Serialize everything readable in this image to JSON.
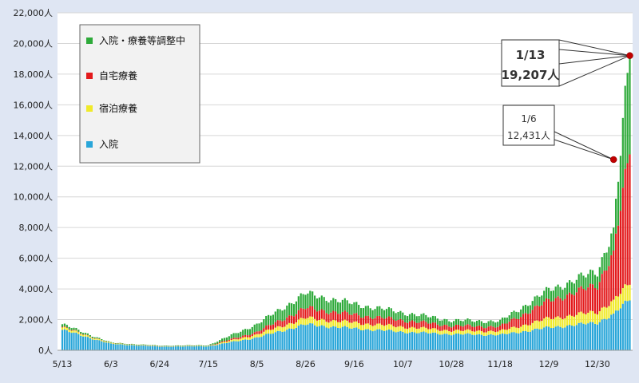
{
  "chart_data": {
    "type": "bar",
    "stacked": true,
    "title": "",
    "xlabel": "",
    "ylabel": "",
    "ylim": [
      0,
      22000
    ],
    "yticks": [
      "0人",
      "2,000人",
      "4,000人",
      "6,000人",
      "8,000人",
      "10,000人",
      "12,000人",
      "14,000人",
      "16,000人",
      "18,000人",
      "20,000人",
      "22,000人"
    ],
    "xticks": [
      "5/13",
      "6/3",
      "6/24",
      "7/15",
      "8/5",
      "8/26",
      "9/16",
      "10/7",
      "10/28",
      "11/18",
      "12/9",
      "12/30"
    ],
    "grid": true,
    "legend_position": "top-left",
    "series": [
      {
        "name": "入院",
        "color": "#29a6d9",
        "values": [
          1330,
          420,
          240,
          260,
          830,
          1680,
          1420,
          1200,
          1050,
          1000,
          1480,
          1800,
          2400,
          3250
        ]
      },
      {
        "name": "宿泊療養",
        "color": "#f0ea2a",
        "values": [
          160,
          40,
          20,
          20,
          200,
          420,
          380,
          330,
          240,
          240,
          590,
          700,
          900,
          1020
        ]
      },
      {
        "name": "自宅療養",
        "color": "#e31a1c",
        "values": [
          40,
          10,
          10,
          10,
          170,
          650,
          520,
          430,
          310,
          300,
          1150,
          1750,
          3200,
          8500
        ]
      },
      {
        "name": "入院・療養等調整中",
        "color": "#2eaa3a",
        "values": [
          170,
          30,
          30,
          40,
          500,
          950,
          700,
          500,
          350,
          350,
          700,
          900,
          1500,
          6437
        ]
      }
    ],
    "key_dates": [
      "5/13",
      "6/3",
      "6/24",
      "7/15",
      "8/5",
      "8/26",
      "9/16",
      "10/7",
      "10/28",
      "11/18",
      "12/9",
      "12/30",
      "1/6",
      "1/13"
    ],
    "annotations": [
      {
        "date": "1/13",
        "value_label": "19,207人",
        "value": 19207
      },
      {
        "date": "1/6",
        "value_label": "12,431人",
        "value": 12431
      }
    ]
  }
}
